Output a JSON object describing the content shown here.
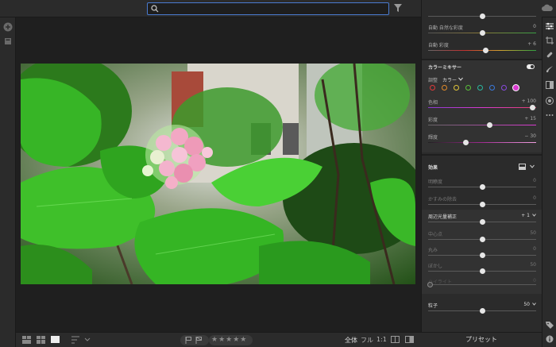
{
  "search": {
    "placeholder": ""
  },
  "panel": {
    "row_top_1": {
      "label": "自動 自然な彩度",
      "value": "0",
      "pos": 0.47
    },
    "row_top_2": {
      "label": "自動 彩度",
      "value": "+ 6",
      "pos": 0.5
    },
    "color_mixer": {
      "title": "カラーミキサー",
      "adjust_label": "調整",
      "adjust_value": "カラー",
      "colors": [
        "#e03a3a",
        "#e08a2a",
        "#e0c53a",
        "#5ac03a",
        "#2ab8a0",
        "#3a7be0",
        "#8a4ae0",
        "#d93ad0"
      ],
      "sliders": [
        {
          "label": "色相",
          "value": "+ 100",
          "pos": 1.0
        },
        {
          "label": "彩度",
          "value": "+ 15",
          "pos": 0.57
        },
        {
          "label": "輝度",
          "value": "− 30",
          "pos": 0.35
        }
      ]
    },
    "effects": {
      "title": "効果",
      "sliders": [
        {
          "label": "明瞭度",
          "value": "0",
          "pos": 0.5
        },
        {
          "label": "かすみの除去",
          "value": "0",
          "pos": 0.5
        }
      ],
      "vignette_label": "周辺光量補正",
      "vignette_value": "+ 1",
      "vignette_pos": 0.5,
      "sub_sliders": [
        {
          "label": "中心点",
          "value": "50",
          "pos": 0.5
        },
        {
          "label": "丸み",
          "value": "0",
          "pos": 0.5
        },
        {
          "label": "ぼかし",
          "value": "50",
          "pos": 0.5
        },
        {
          "label": "ハイライト",
          "value": "0",
          "pos": 0.0
        }
      ],
      "grain_label": "粒子",
      "grain_value": "50",
      "grain_pos": 0.5
    }
  },
  "preset_label": "プリセット",
  "bottom": {
    "zoom_all": "全体",
    "zoom_full": "フル",
    "zoom_1to1": "1:1",
    "stars": "★★★★★"
  }
}
